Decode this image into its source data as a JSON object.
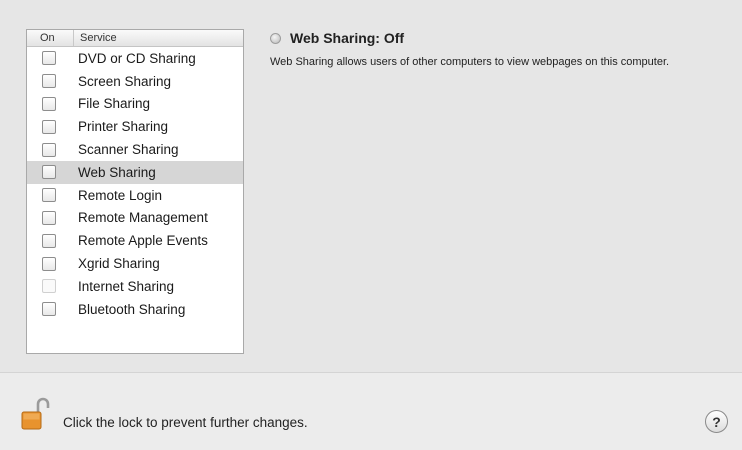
{
  "services": {
    "header": {
      "on": "On",
      "service": "Service"
    },
    "items": [
      {
        "label": "DVD or CD Sharing",
        "checked": false,
        "enabled": true
      },
      {
        "label": "Screen Sharing",
        "checked": false,
        "enabled": true
      },
      {
        "label": "File Sharing",
        "checked": false,
        "enabled": true
      },
      {
        "label": "Printer Sharing",
        "checked": false,
        "enabled": true
      },
      {
        "label": "Scanner Sharing",
        "checked": false,
        "enabled": true
      },
      {
        "label": "Web Sharing",
        "checked": false,
        "enabled": true,
        "selected": true
      },
      {
        "label": "Remote Login",
        "checked": false,
        "enabled": true
      },
      {
        "label": "Remote Management",
        "checked": false,
        "enabled": true
      },
      {
        "label": "Remote Apple Events",
        "checked": false,
        "enabled": true
      },
      {
        "label": "Xgrid Sharing",
        "checked": false,
        "enabled": true
      },
      {
        "label": "Internet Sharing",
        "checked": false,
        "enabled": false
      },
      {
        "label": "Bluetooth Sharing",
        "checked": false,
        "enabled": true
      }
    ]
  },
  "status": {
    "icon": "status-off-icon",
    "title": "Web Sharing: Off",
    "description": "Web Sharing allows users of other computers to view webpages on this computer."
  },
  "footer": {
    "lock_icon": "unlocked-padlock-icon",
    "lock_text": "Click the lock to prevent further changes.",
    "help_label": "?"
  },
  "colors": {
    "background": "#e6e6e6",
    "selection": "#d6d6d6",
    "lock": "#e8932e"
  }
}
